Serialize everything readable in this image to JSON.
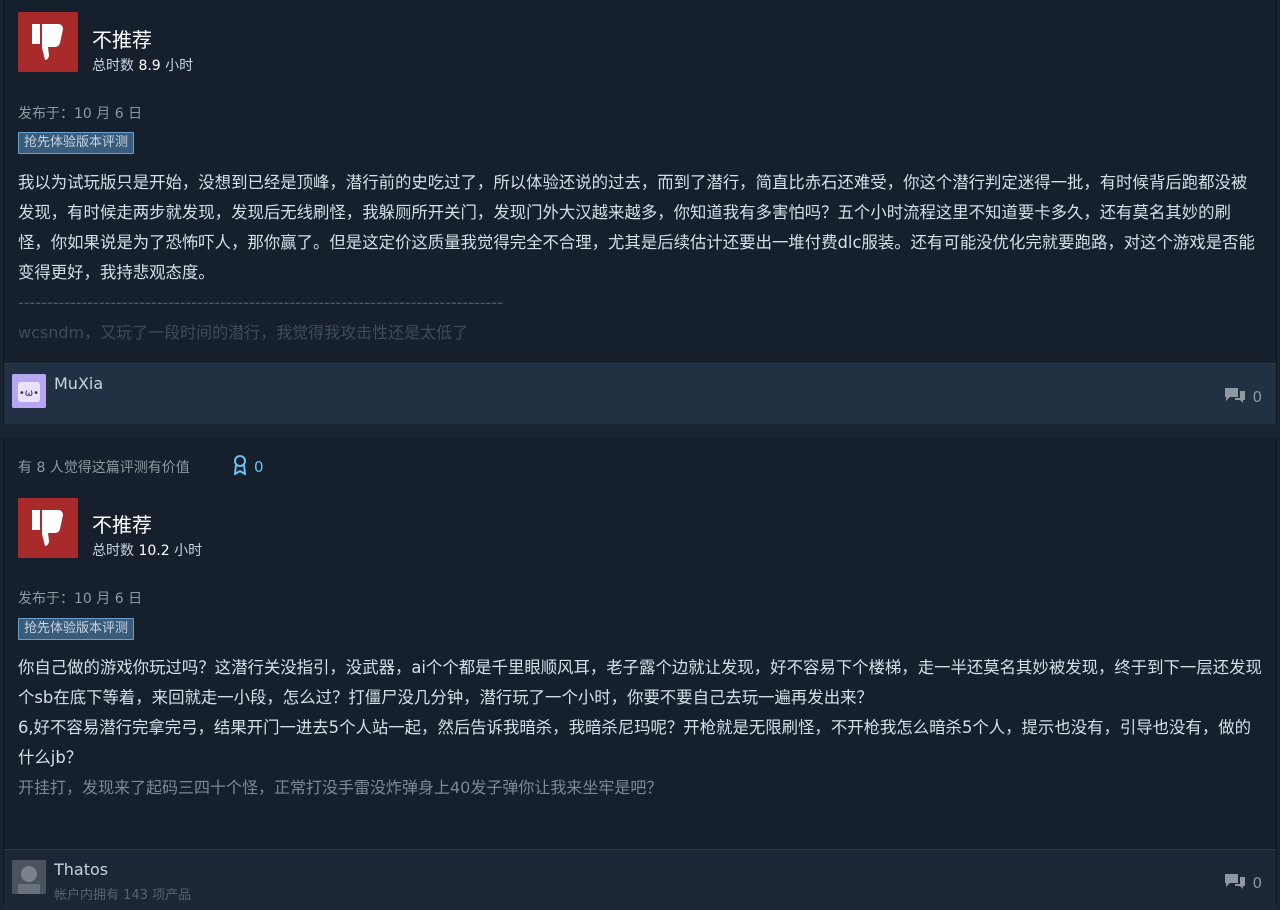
{
  "reviews": [
    {
      "verdict": "不推荐",
      "hours_prefix": "总时数",
      "hours_value": "8.9",
      "hours_suffix": "小时",
      "posted": "发布于：10 月 6 日",
      "tag": "抢先体验版本评测",
      "body": "我以为试玩版只是开始，没想到已经是顶峰，潜行前的史吃过了，所以体验还说的过去，而到了潜行，简直比赤石还难受，你这个潜行判定迷得一批，有时候背后跑都没被发现，有时候走两步就发现，发现后无线刷怪，我躲厕所开关门，发现门外大汉越来越多，你知道我有多害怕吗？五个小时流程这里不知道要卡多久，还有莫名其妙的刷怪，你如果说是为了恐怖吓人，那你赢了。但是这定价这质量我觉得完全不合理，尤其是后续估计还要出一堆付费dlc服装。还有可能没优化完就要跑路，对这个游戏是否能变得更好，我持悲观态度。",
      "divider": "------------------------------------------------------------------------------------",
      "faded": "wcsndm，又玩了一段时间的潜行，我觉得我攻击性还是太低了",
      "author": "MuXia",
      "author_sub": "",
      "comments": "0"
    },
    {
      "helpful": "有 8 人觉得这篇评测有价值",
      "awards": "0",
      "verdict": "不推荐",
      "hours_prefix": "总时数",
      "hours_value": "10.2",
      "hours_suffix": "小时",
      "posted": "发布于：10 月 6 日",
      "tag": "抢先体验版本评测",
      "body_lines": [
        "你自己做的游戏你玩过吗？这潜行关没指引，没武器，ai个个都是千里眼顺风耳，老子露个边就让发现，好不容易下个楼梯，走一半还莫名其妙被发现，终于到下一层还发现个sb在底下等着，来回就走一小段，怎么过？打僵尸没几分钟，潜行玩了一个小时，你要不要自己去玩一遍再发出来？",
        "6,好不容易潜行完拿完弓，结果开门一进去5个人站一起，然后告诉我暗杀，我暗杀尼玛呢？开枪就是无限刷怪，不开枪我怎么暗杀5个人，提示也没有，引导也没有，做的什么jb？"
      ],
      "faded": "开挂打，发现来了起码三四十个怪，正常打没手雷没炸弹身上40发子弹你让我来坐牢是吧？",
      "author": "Thatos",
      "author_sub": "帐户内拥有 143 项产品",
      "comments": "0"
    }
  ],
  "colors": {
    "thumb_bg": "#a92a2a",
    "tag_bg": "#3a5c7c",
    "link": "#67c1f5",
    "footer_bg": "#213042"
  }
}
